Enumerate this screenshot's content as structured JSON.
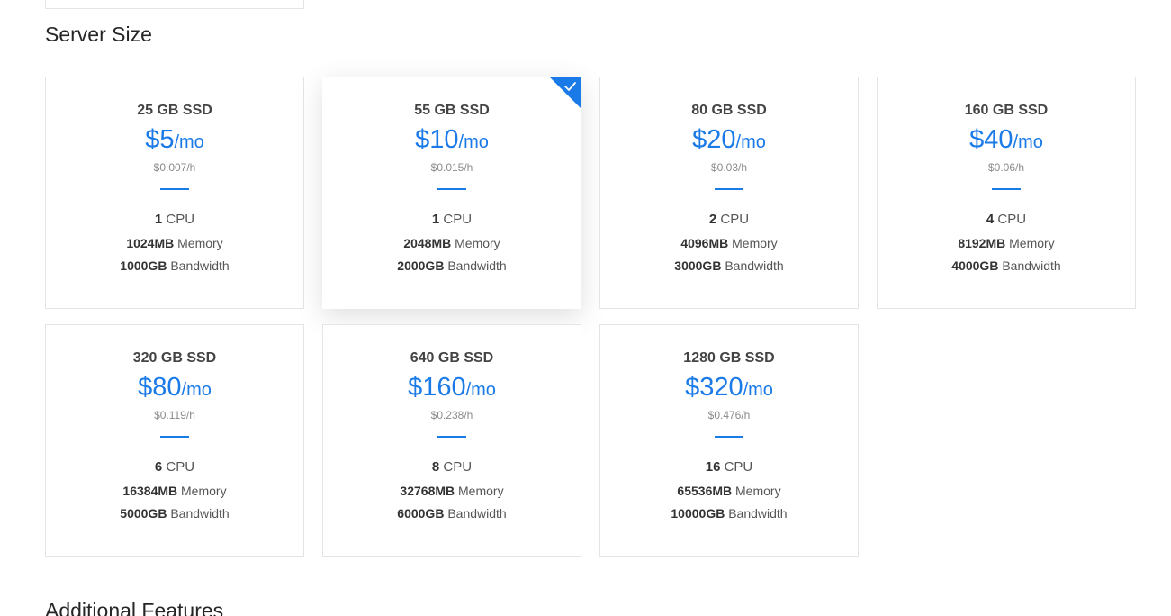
{
  "sections": {
    "server_size": "Server Size",
    "additional_features": "Additional Features"
  },
  "colors": {
    "accent": "#1a7ae8",
    "border": "#e4e4e4"
  },
  "units": {
    "per_month": "/mo",
    "cpu": "CPU",
    "memory": "Memory",
    "bandwidth": "Bandwidth"
  },
  "plans": [
    {
      "disk": "25 GB SSD",
      "price": "$5",
      "hourly": "$0.007/h",
      "cpu": "1",
      "memory": "1024MB",
      "bandwidth": "1000GB",
      "selected": false
    },
    {
      "disk": "55 GB SSD",
      "price": "$10",
      "hourly": "$0.015/h",
      "cpu": "1",
      "memory": "2048MB",
      "bandwidth": "2000GB",
      "selected": true
    },
    {
      "disk": "80 GB SSD",
      "price": "$20",
      "hourly": "$0.03/h",
      "cpu": "2",
      "memory": "4096MB",
      "bandwidth": "3000GB",
      "selected": false
    },
    {
      "disk": "160 GB SSD",
      "price": "$40",
      "hourly": "$0.06/h",
      "cpu": "4",
      "memory": "8192MB",
      "bandwidth": "4000GB",
      "selected": false
    },
    {
      "disk": "320 GB SSD",
      "price": "$80",
      "hourly": "$0.119/h",
      "cpu": "6",
      "memory": "16384MB",
      "bandwidth": "5000GB",
      "selected": false
    },
    {
      "disk": "640 GB SSD",
      "price": "$160",
      "hourly": "$0.238/h",
      "cpu": "8",
      "memory": "32768MB",
      "bandwidth": "6000GB",
      "selected": false
    },
    {
      "disk": "1280 GB SSD",
      "price": "$320",
      "hourly": "$0.476/h",
      "cpu": "16",
      "memory": "65536MB",
      "bandwidth": "10000GB",
      "selected": false
    }
  ]
}
